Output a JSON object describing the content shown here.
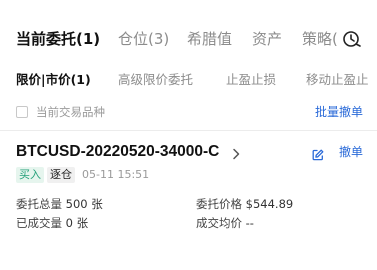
{
  "tabs": {
    "items": [
      {
        "label": "当前委托(1)",
        "active": true
      },
      {
        "label": "仓位(3)",
        "active": false
      },
      {
        "label": "希腊值",
        "active": false
      },
      {
        "label": "资产",
        "active": false
      },
      {
        "label": "策略(",
        "active": false
      }
    ]
  },
  "subtabs": {
    "items": [
      {
        "label": "限价|市价(1)",
        "active": true
      },
      {
        "label": "高级限价委托",
        "active": false
      },
      {
        "label": "止盈止损",
        "active": false
      },
      {
        "label": "移动止盈止",
        "active": false
      }
    ]
  },
  "filter": {
    "checkbox_label": "当前交易品种",
    "checked": false,
    "batch_cancel": "批量撤单"
  },
  "order": {
    "symbol": "BTCUSD-20220520-34000-C",
    "side": "买入",
    "type": "逐仓",
    "time": "05-11 15:51",
    "cancel": "撤单",
    "total_label": "委托总量",
    "total_value": "500 张",
    "price_label": "委托价格",
    "price_value": "$544.89",
    "filled_label": "已成交量",
    "filled_value": "0 张",
    "avg_label": "成交均价",
    "avg_value": "--"
  },
  "colors": {
    "accent": "#2a6ad8",
    "buy": "#26a17b"
  },
  "icons": {
    "more": "clock-refresh-icon",
    "chevron": "chevron-right-icon",
    "edit": "edit-icon"
  }
}
